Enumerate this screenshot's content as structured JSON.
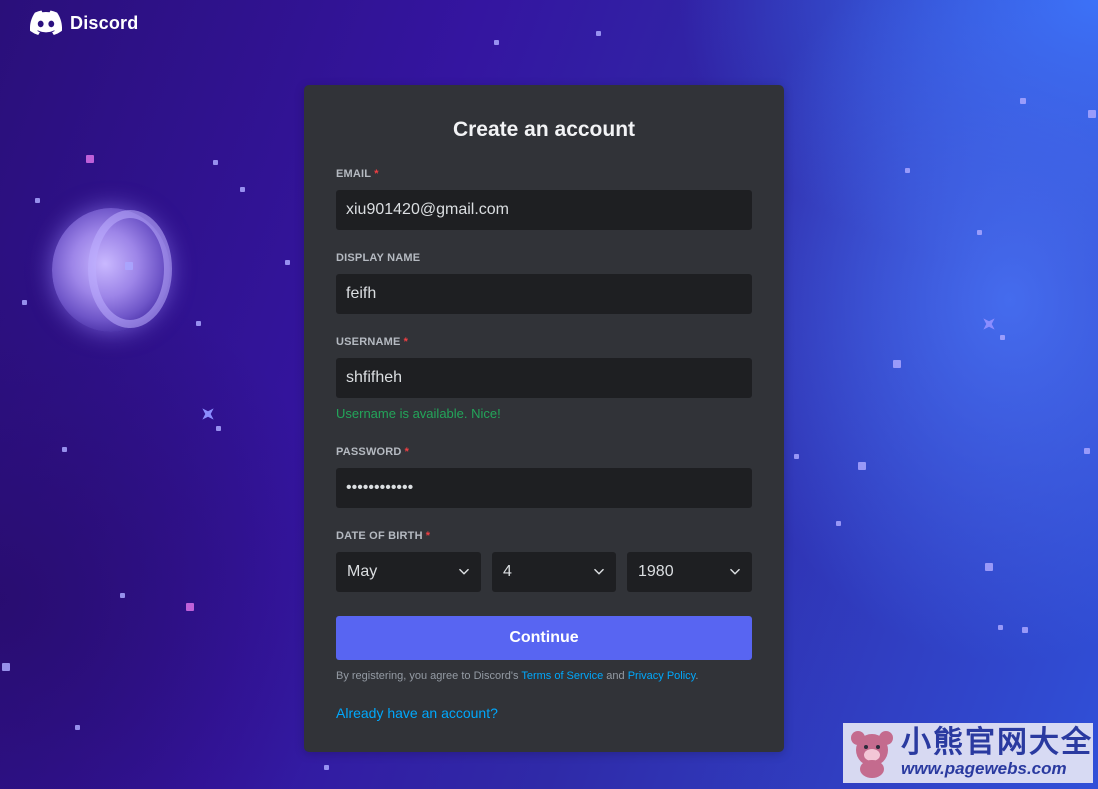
{
  "brand": {
    "name": "Discord"
  },
  "form": {
    "title": "Create an account",
    "email": {
      "label": "EMAIL",
      "required_mark": "*",
      "value": "xiu901420@gmail.com"
    },
    "display_name": {
      "label": "DISPLAY NAME",
      "value": "feifh"
    },
    "username": {
      "label": "USERNAME",
      "required_mark": "*",
      "value": "shfifheh",
      "hint": "Username is available. Nice!"
    },
    "password": {
      "label": "PASSWORD",
      "required_mark": "*",
      "value": "shfifheh1234"
    },
    "dob": {
      "label": "DATE OF BIRTH",
      "required_mark": "*",
      "month": "May",
      "day": "4",
      "year": "1980"
    },
    "continue_label": "Continue",
    "terms": {
      "prefix": "By registering, you agree to Discord's ",
      "tos_link": "Terms of Service",
      "middle": " and ",
      "privacy_link": "Privacy Policy",
      "suffix": "."
    },
    "login_link": "Already have an account?"
  },
  "watermark": {
    "title": "小熊官网大全",
    "url": "www.pagewebs.com"
  },
  "colors": {
    "card": "#313338",
    "input": "#1e1f22",
    "primary": "#5865f2",
    "link": "#00a8fc",
    "success": "#23a55a",
    "required": "#f23f43"
  }
}
